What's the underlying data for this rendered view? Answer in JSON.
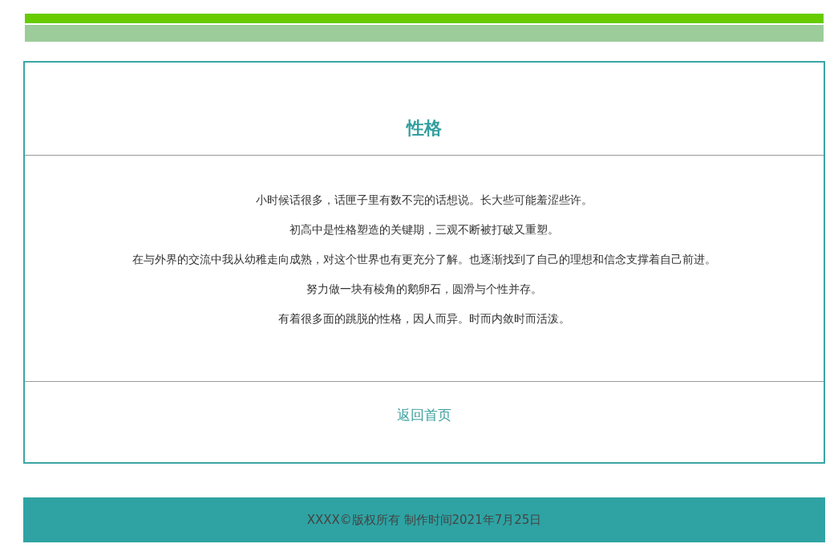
{
  "card": {
    "title": "性格",
    "paragraphs": [
      "小时候话很多，话匣子里有数不完的话想说。长大些可能羞涩些许。",
      "初高中是性格塑造的关键期，三观不断被打破又重塑。",
      "在与外界的交流中我从幼稚走向成熟，对这个世界也有更充分了解。也逐渐找到了自己的理想和信念支撑着自己前进。",
      "努力做一块有棱角的鹅卵石，圆滑与个性并存。",
      "有着很多面的跳脱的性格，因人而异。时而内敛时而活泼。"
    ],
    "back_link": "返回首页"
  },
  "footer": {
    "text": "XXXX©版权所有 制作时间2021年7月25日"
  }
}
